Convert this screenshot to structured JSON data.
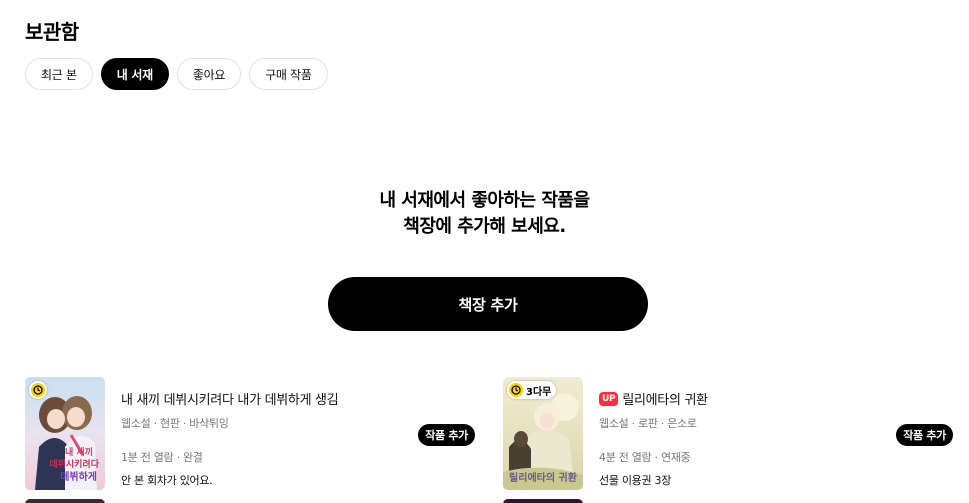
{
  "page": {
    "title": "보관함"
  },
  "tabs": [
    {
      "label": "최근 본",
      "active": false
    },
    {
      "label": "내 서재",
      "active": true
    },
    {
      "label": "좋아요",
      "active": false
    },
    {
      "label": "구매 작품",
      "active": false
    }
  ],
  "empty": {
    "line1": "내 서재에서 좋아하는 작품을",
    "line2": "책장에 추가해 보세요.",
    "button": "책장 추가"
  },
  "books": [
    {
      "title": "내 새끼 데뷔시키려다 내가 데뷔하게 생김",
      "meta": "웹소설 · 현판 · 바삭튀잉",
      "read": "1분 전 열람 · 완결",
      "extra": "안 본 회차가 있어요.",
      "add_label": "작품 추가",
      "badge": ""
    },
    {
      "up_label": "UP",
      "title": "릴리에타의 귀환",
      "meta": "웹소설 · 로판 · 은소로",
      "read": "4분 전 열람 · 연재중",
      "extra": "선물 이용권 3장",
      "add_label": "작품 추가",
      "badge": "3다무"
    }
  ],
  "colors": {
    "accent": "#000000",
    "up_badge": "#fe2c3d",
    "clock": "#ffd400"
  }
}
